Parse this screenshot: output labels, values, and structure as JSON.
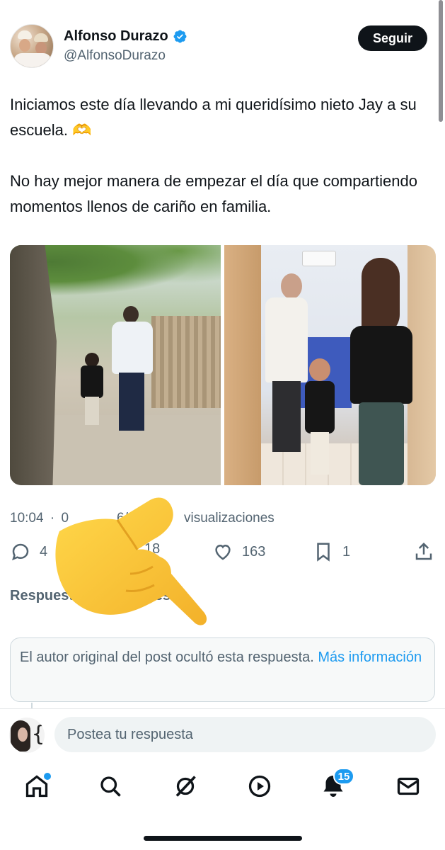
{
  "author": {
    "name": "Alfonso Durazo",
    "handle": "@AlfonsoDurazo",
    "verified": true,
    "follow_label": "Seguir"
  },
  "post": {
    "paragraph1": "Iniciamos este día llevando a mi queridísimo nieto Jay a su escuela. 🫶",
    "paragraph2": "No hay mejor manera de empezar el día que compartiendo momentos llenos de cariño en familia.",
    "meta_time": "10:04",
    "meta_sep": "·",
    "meta_date_partial": "0",
    "meta_date_partial2": "6/25",
    "meta_views_label": "visualizaciones",
    "media": [
      {
        "icon": "photo-walking-to-school"
      },
      {
        "icon": "photo-at-classroom-door"
      }
    ]
  },
  "actions": {
    "replies_partial": "4",
    "reposts_partial": "18",
    "likes": "163",
    "bookmarks": "1"
  },
  "replies_filter": {
    "label_partial_left": "Respuest",
    "label_partial_right": "tes"
  },
  "hidden_reply": {
    "text": "El autor original del post ocultó esta respuesta.",
    "link": "Más información"
  },
  "composer": {
    "placeholder": "Postea tu respuesta"
  },
  "tabbar": {
    "notifications_badge": "15",
    "items": [
      "home-icon",
      "search-icon",
      "grok-icon",
      "video-icon",
      "bell-icon",
      "mail-icon"
    ]
  },
  "overlay": {
    "emoji": "backhand-index-pointing-down-emoji"
  },
  "colors": {
    "accent": "#1d9bf0",
    "text": "#0f1419",
    "secondary": "#536471"
  }
}
